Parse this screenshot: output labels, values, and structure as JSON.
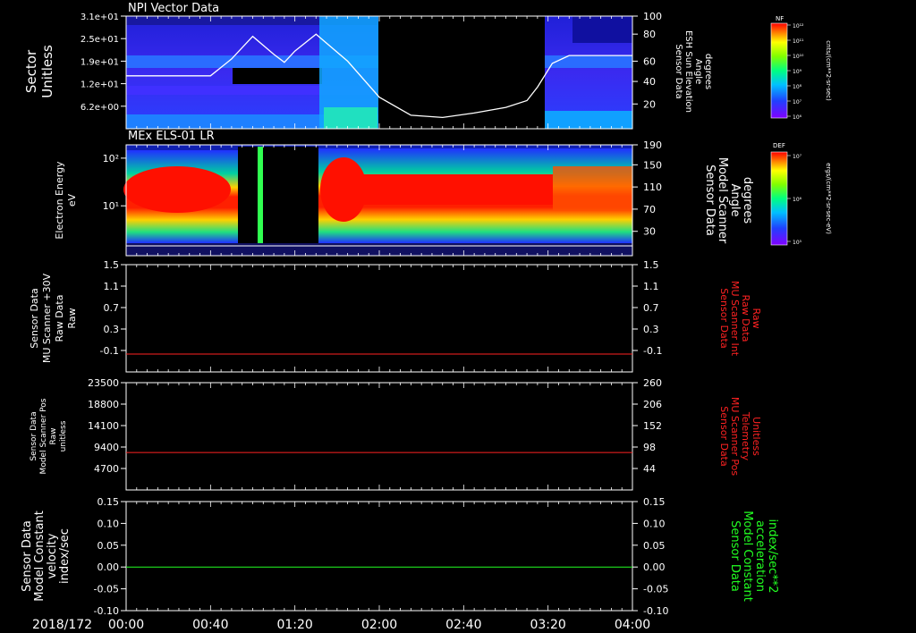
{
  "date_label": "2018/172",
  "time_ticks": [
    "00:00",
    "00:40",
    "01:20",
    "02:00",
    "02:40",
    "03:20",
    "04:00"
  ],
  "panels": [
    {
      "id": "npi",
      "title": "NPI Vector Data",
      "left_label": [
        "Sector",
        "Unitless"
      ],
      "left_ticks": [
        "3.1e+01",
        "2.5e+01",
        "1.9e+01",
        "1.2e+01",
        "6.2e+00"
      ],
      "right_label": [
        "Sensor Data",
        "ESH Sun Elevation",
        "Angle",
        "degrees"
      ],
      "right_ticks": [
        "100",
        "80",
        "60",
        "40",
        "20"
      ],
      "colorbar": {
        "tag": "NF",
        "ticks": [
          "10¹²",
          "10¹¹",
          "10¹⁰",
          "10⁹",
          "10⁸",
          "10⁷",
          "10⁶"
        ],
        "unit": "cnts/(cm**2-sr-sec)"
      }
    },
    {
      "id": "els",
      "title": "MEx ELS-01 LR",
      "left_label": [
        "Electron Energy",
        "eV"
      ],
      "left_ticks": [
        "10²",
        "10¹"
      ],
      "right_label": [
        "Sensor Data",
        "Model Scanner",
        "Angle",
        "degrees"
      ],
      "right_ticks": [
        "190",
        "150",
        "110",
        "70",
        "30"
      ],
      "colorbar": {
        "tag": "DEF",
        "ticks": [
          "10⁷",
          "10⁶",
          "10⁵"
        ],
        "unit": "ergs/(cm**2-sr-sec-eV)"
      }
    },
    {
      "id": "scanner-int",
      "left_label": [
        "Sensor Data",
        "MU Scanner +30V",
        "Raw Data",
        "Raw"
      ],
      "left_ticks": [
        "1.5",
        "1.1",
        "0.7",
        "0.3",
        "-0.1"
      ],
      "right_label": [
        "Sensor Data",
        "MU Scanner Int",
        "Raw Data",
        "Raw"
      ],
      "right_ticks": [
        "1.5",
        "1.1",
        "0.7",
        "0.3",
        "-0.1"
      ]
    },
    {
      "id": "scanner-pos",
      "left_label": [
        "Sensor Data",
        "Model Scanner Pos",
        "Raw",
        "unitless"
      ],
      "left_ticks": [
        "23500",
        "18800",
        "14100",
        "9400",
        "4700"
      ],
      "right_label": [
        "Sensor Data",
        "MU Scanner Pos",
        "Telemetry",
        "Unitless"
      ],
      "right_ticks": [
        "260",
        "206",
        "152",
        "98",
        "44"
      ]
    },
    {
      "id": "velocity",
      "left_label": [
        "Sensor Data",
        "Model Constant",
        "velocity",
        "index/sec"
      ],
      "left_ticks": [
        "0.15",
        "0.10",
        "0.05",
        "0.00",
        "-0.05",
        "-0.10"
      ],
      "right_label": [
        "Sensor Data",
        "Model Constant",
        "acceleration",
        "index/sec**2"
      ],
      "right_ticks": [
        "0.15",
        "0.10",
        "0.05",
        "0.00",
        "-0.05",
        "-0.10"
      ]
    }
  ],
  "chart_data": [
    {
      "type": "heatmap",
      "title": "NPI Vector Data",
      "xlabel": "",
      "ylabel": "Sector Unitless",
      "x_range": [
        "00:00",
        "04:00"
      ],
      "ylim": [
        0,
        31
      ],
      "data_gap": [
        "01:51",
        "03:10"
      ],
      "overlay_line": {
        "name": "Sensor Data ESH Sun Elevation Angle degrees",
        "ylim": [
          0,
          100
        ],
        "x": [
          "00:00",
          "00:40",
          "00:50",
          "01:00",
          "01:10",
          "01:15",
          "01:20",
          "01:30",
          "01:45",
          "02:00",
          "02:15",
          "02:30",
          "02:45",
          "03:00",
          "03:10",
          "03:15",
          "03:22",
          "03:30",
          "04:00"
        ],
        "y": [
          47,
          47,
          62,
          82,
          66,
          59,
          69,
          84,
          60,
          28,
          12,
          10,
          14,
          19,
          25,
          37,
          58,
          65,
          65
        ],
        "color": "#ffffff"
      }
    },
    {
      "type": "heatmap",
      "title": "MEx ELS-01 LR",
      "xlabel": "",
      "ylabel": "Electron Energy eV",
      "x_range": [
        "00:00",
        "04:00"
      ],
      "y_scale": "log",
      "overlay_line": {
        "name": "Sensor Data Model Scanner Angle degrees",
        "ylim": [
          0,
          190
        ],
        "x": [
          "00:00",
          "04:00"
        ],
        "y": [
          5,
          5
        ],
        "color": "#ffffff"
      }
    },
    {
      "type": "line",
      "series": [
        {
          "values": [
            0.0,
            0.0
          ],
          "color": "#ff2222"
        }
      ],
      "x": [
        "00:00",
        "04:00"
      ],
      "ylim": [
        -0.3,
        1.5
      ],
      "ylabel": "Sensor Data MU Scanner +30V Raw Data Raw"
    },
    {
      "type": "line",
      "series": [
        {
          "values": [
            8200,
            8200
          ],
          "color": "#ff2222"
        }
      ],
      "x": [
        "00:00",
        "04:00"
      ],
      "ylim": [
        0,
        23500
      ],
      "ylabel": "Sensor Data Model Scanner Pos Raw unitless"
    },
    {
      "type": "line",
      "series": [
        {
          "values": [
            0.0,
            0.0
          ],
          "color": "#22ff22"
        }
      ],
      "x": [
        "00:00",
        "04:00"
      ],
      "ylim": [
        -0.1,
        0.15
      ],
      "ylabel": "Sensor Data Model Constant velocity index/sec"
    }
  ]
}
